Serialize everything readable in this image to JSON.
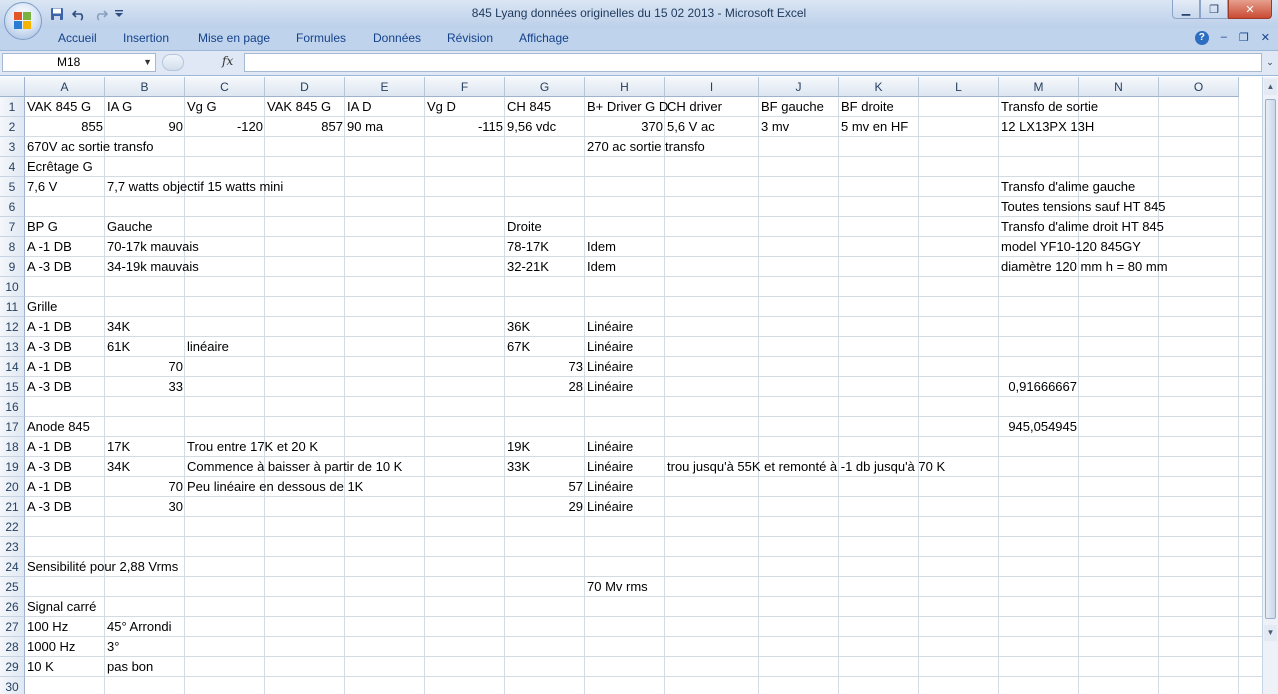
{
  "window": {
    "title": "845 Lyang données originelles du 15 02 2013 - Microsoft Excel",
    "controls": {
      "minimize": "▁",
      "restore": "❐",
      "close": "✕"
    }
  },
  "quick_access": {
    "save_icon": "save-icon",
    "undo_icon": "undo-icon",
    "redo_icon": "redo-icon",
    "customize_icon": "chevron-down-icon"
  },
  "ribbon": {
    "tabs": [
      "Accueil",
      "Insertion",
      "Mise en page",
      "Formules",
      "Données",
      "Révision",
      "Affichage"
    ],
    "help": "?",
    "doc_controls": {
      "minimize": "–",
      "restore": "❐",
      "close": "✕"
    }
  },
  "formula_bar": {
    "name_box": "M18",
    "fx": "fx",
    "value": ""
  },
  "grid": {
    "columns": [
      "A",
      "B",
      "C",
      "D",
      "E",
      "F",
      "G",
      "H",
      "I",
      "J",
      "K",
      "L",
      "M",
      "N",
      "O"
    ],
    "rows": [
      "1",
      "2",
      "3",
      "4",
      "5",
      "6",
      "7",
      "8",
      "9",
      "10",
      "11",
      "12",
      "13",
      "14",
      "15",
      "16",
      "17",
      "18",
      "19",
      "20",
      "21",
      "22",
      "23",
      "24",
      "25",
      "26",
      "27",
      "28",
      "29",
      "30"
    ],
    "cells": [
      {
        "c": "A",
        "r": 1,
        "v": "VAK 845 G"
      },
      {
        "c": "B",
        "r": 1,
        "v": "IA G"
      },
      {
        "c": "C",
        "r": 1,
        "v": "Vg G"
      },
      {
        "c": "D",
        "r": 1,
        "v": "VAK 845 G"
      },
      {
        "c": "E",
        "r": 1,
        "v": "IA D"
      },
      {
        "c": "F",
        "r": 1,
        "v": "Vg D"
      },
      {
        "c": "G",
        "r": 1,
        "v": "CH 845"
      },
      {
        "c": "H",
        "r": 1,
        "v": "B+ Driver G D"
      },
      {
        "c": "I",
        "r": 1,
        "v": "CH driver"
      },
      {
        "c": "J",
        "r": 1,
        "v": "BF gauche"
      },
      {
        "c": "K",
        "r": 1,
        "v": "BF droite"
      },
      {
        "c": "M",
        "r": 1,
        "v": "Transfo de sortie"
      },
      {
        "c": "A",
        "r": 2,
        "v": "855",
        "n": true
      },
      {
        "c": "B",
        "r": 2,
        "v": "90",
        "n": true
      },
      {
        "c": "C",
        "r": 2,
        "v": "-120",
        "n": true
      },
      {
        "c": "D",
        "r": 2,
        "v": "857",
        "n": true
      },
      {
        "c": "E",
        "r": 2,
        "v": "90 ma"
      },
      {
        "c": "F",
        "r": 2,
        "v": "-115",
        "n": true
      },
      {
        "c": "G",
        "r": 2,
        "v": "9,56 vdc"
      },
      {
        "c": "H",
        "r": 2,
        "v": "370",
        "n": true
      },
      {
        "c": "I",
        "r": 2,
        "v": "5,6 V ac"
      },
      {
        "c": "J",
        "r": 2,
        "v": "3 mv"
      },
      {
        "c": "K",
        "r": 2,
        "v": "5 mv en HF"
      },
      {
        "c": "M",
        "r": 2,
        "v": "12 LX13PX 13H"
      },
      {
        "c": "A",
        "r": 3,
        "v": "670V ac sortie transfo"
      },
      {
        "c": "H",
        "r": 3,
        "v": "270 ac sortie transfo"
      },
      {
        "c": "A",
        "r": 4,
        "v": "Ecrêtage G"
      },
      {
        "c": "A",
        "r": 5,
        "v": "7,6 V"
      },
      {
        "c": "B",
        "r": 5,
        "v": "7,7 watts objectif 15 watts mini"
      },
      {
        "c": "M",
        "r": 5,
        "v": "Transfo d'alime gauche"
      },
      {
        "c": "M",
        "r": 6,
        "v": "Toutes tensions sauf HT 845"
      },
      {
        "c": "A",
        "r": 7,
        "v": "BP G"
      },
      {
        "c": "B",
        "r": 7,
        "v": "Gauche"
      },
      {
        "c": "G",
        "r": 7,
        "v": "Droite"
      },
      {
        "c": "M",
        "r": 7,
        "v": "Transfo d'alime droit HT 845"
      },
      {
        "c": "A",
        "r": 8,
        "v": "A -1 DB"
      },
      {
        "c": "B",
        "r": 8,
        "v": "70-17k mauvais"
      },
      {
        "c": "G",
        "r": 8,
        "v": "78-17K"
      },
      {
        "c": "H",
        "r": 8,
        "v": "Idem"
      },
      {
        "c": "M",
        "r": 8,
        "v": "model YF10-120 845GY"
      },
      {
        "c": "A",
        "r": 9,
        "v": "A -3 DB"
      },
      {
        "c": "B",
        "r": 9,
        "v": "34-19k mauvais"
      },
      {
        "c": "G",
        "r": 9,
        "v": "32-21K"
      },
      {
        "c": "H",
        "r": 9,
        "v": "Idem"
      },
      {
        "c": "M",
        "r": 9,
        "v": "diamètre 120 mm h = 80 mm"
      },
      {
        "c": "A",
        "r": 11,
        "v": "Grille"
      },
      {
        "c": "A",
        "r": 12,
        "v": "A -1 DB"
      },
      {
        "c": "B",
        "r": 12,
        "v": "34K"
      },
      {
        "c": "G",
        "r": 12,
        "v": "36K"
      },
      {
        "c": "H",
        "r": 12,
        "v": "Linéaire"
      },
      {
        "c": "A",
        "r": 13,
        "v": "A -3 DB"
      },
      {
        "c": "B",
        "r": 13,
        "v": "61K"
      },
      {
        "c": "C",
        "r": 13,
        "v": " linéaire"
      },
      {
        "c": "G",
        "r": 13,
        "v": "67K"
      },
      {
        "c": "H",
        "r": 13,
        "v": "Linéaire"
      },
      {
        "c": "A",
        "r": 14,
        "v": "A -1 DB"
      },
      {
        "c": "B",
        "r": 14,
        "v": "70",
        "n": true
      },
      {
        "c": "G",
        "r": 14,
        "v": "73",
        "n": true
      },
      {
        "c": "H",
        "r": 14,
        "v": "Linéaire"
      },
      {
        "c": "A",
        "r": 15,
        "v": "A -3 DB"
      },
      {
        "c": "B",
        "r": 15,
        "v": "33",
        "n": true
      },
      {
        "c": "G",
        "r": 15,
        "v": "28",
        "n": true
      },
      {
        "c": "H",
        "r": 15,
        "v": "Linéaire"
      },
      {
        "c": "M",
        "r": 15,
        "v": "0,91666667",
        "n": true
      },
      {
        "c": "A",
        "r": 17,
        "v": "Anode 845"
      },
      {
        "c": "M",
        "r": 17,
        "v": "945,054945",
        "n": true
      },
      {
        "c": "A",
        "r": 18,
        "v": "A -1 DB"
      },
      {
        "c": "B",
        "r": 18,
        "v": "17K"
      },
      {
        "c": "C",
        "r": 18,
        "v": "Trou entre 17K et 20 K"
      },
      {
        "c": "G",
        "r": 18,
        "v": "19K"
      },
      {
        "c": "H",
        "r": 18,
        "v": "Linéaire"
      },
      {
        "c": "A",
        "r": 19,
        "v": "A -3 DB"
      },
      {
        "c": "B",
        "r": 19,
        "v": "34K"
      },
      {
        "c": "C",
        "r": 19,
        "v": "Commence à baisser à partir de 10 K"
      },
      {
        "c": "G",
        "r": 19,
        "v": "33K"
      },
      {
        "c": "H",
        "r": 19,
        "v": "Linéaire"
      },
      {
        "c": "I",
        "r": 19,
        "v": "trou jusqu'à 55K et remonté à -1 db jusqu'à 70 K"
      },
      {
        "c": "A",
        "r": 20,
        "v": "A -1 DB"
      },
      {
        "c": "B",
        "r": 20,
        "v": "70",
        "n": true
      },
      {
        "c": "C",
        "r": 20,
        "v": "Peu linéaire en dessous de 1K"
      },
      {
        "c": "G",
        "r": 20,
        "v": "57",
        "n": true
      },
      {
        "c": "H",
        "r": 20,
        "v": "Linéaire"
      },
      {
        "c": "A",
        "r": 21,
        "v": "A -3 DB"
      },
      {
        "c": "B",
        "r": 21,
        "v": "30",
        "n": true
      },
      {
        "c": "G",
        "r": 21,
        "v": "29",
        "n": true
      },
      {
        "c": "H",
        "r": 21,
        "v": "Linéaire"
      },
      {
        "c": "A",
        "r": 24,
        "v": "Sensibilité pour 2,88 Vrms"
      },
      {
        "c": "H",
        "r": 25,
        "v": "70 Mv rms"
      },
      {
        "c": "A",
        "r": 26,
        "v": "Signal carré"
      },
      {
        "c": "A",
        "r": 27,
        "v": "100 Hz"
      },
      {
        "c": "B",
        "r": 27,
        "v": "45° Arrondi"
      },
      {
        "c": "A",
        "r": 28,
        "v": "1000 Hz"
      },
      {
        "c": "B",
        "r": 28,
        "v": "3°"
      },
      {
        "c": "A",
        "r": 29,
        "v": "10 K"
      },
      {
        "c": "B",
        "r": 29,
        "v": "pas bon"
      }
    ]
  },
  "colors": {
    "header_text": "#15428b",
    "grid_line": "#d4dbe5"
  }
}
